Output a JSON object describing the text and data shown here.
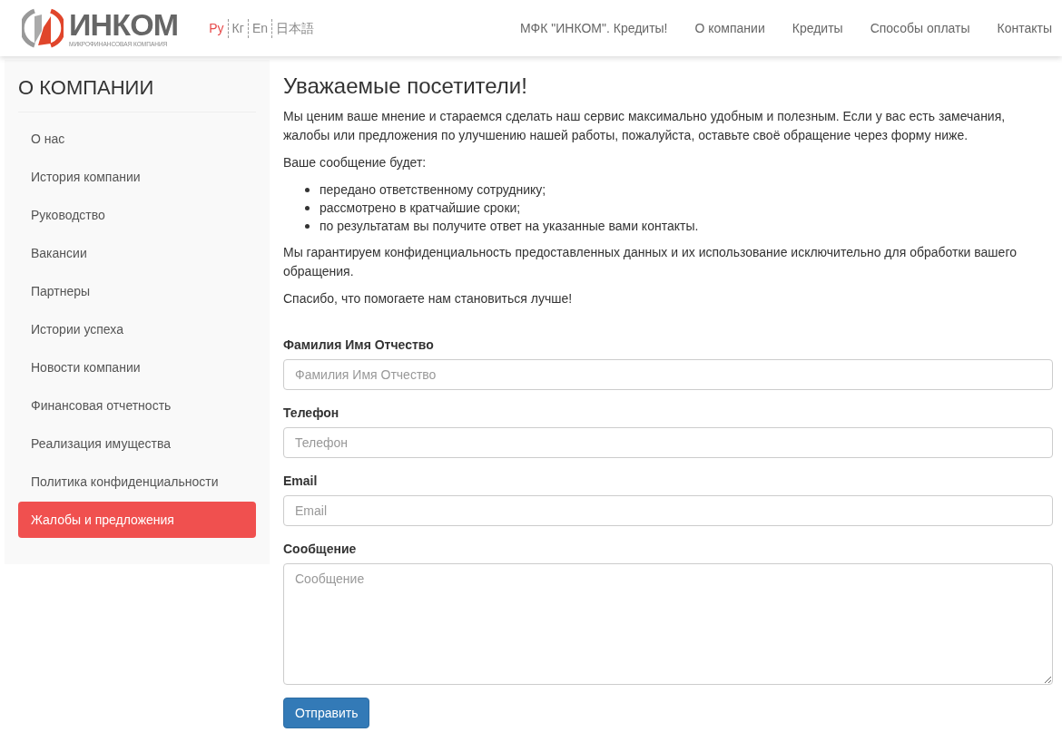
{
  "header": {
    "logo": {
      "name": "ИНКОМ",
      "tagline": "МИКРОФИНАНСОВАЯ КОМПАНИЯ"
    },
    "languages": [
      {
        "label": "Ру",
        "selected": true
      },
      {
        "label": "Кг",
        "selected": false
      },
      {
        "label": "En",
        "selected": false
      },
      {
        "label": "日本語",
        "selected": false
      }
    ],
    "nav": [
      "МФК \"ИНКОМ\". Кредиты!",
      "О компании",
      "Кредиты",
      "Способы оплаты",
      "Контакты"
    ]
  },
  "sidebar": {
    "title": "О КОМПАНИИ",
    "items": [
      {
        "label": "О нас",
        "selected": false
      },
      {
        "label": "История компании",
        "selected": false
      },
      {
        "label": "Руководство",
        "selected": false
      },
      {
        "label": "Вакансии",
        "selected": false
      },
      {
        "label": "Партнеры",
        "selected": false
      },
      {
        "label": "Истории успеха",
        "selected": false
      },
      {
        "label": "Новости компании",
        "selected": false
      },
      {
        "label": "Финансовая отчетность",
        "selected": false
      },
      {
        "label": "Реализация имущества",
        "selected": false
      },
      {
        "label": "Политика конфиденциальности",
        "selected": false
      },
      {
        "label": "Жалобы и предложения",
        "selected": true
      }
    ]
  },
  "main": {
    "heading": "Уважаемые посетители!",
    "intro": "Мы ценим ваше мнение и стараемся сделать наш сервис максимально удобным и полезным. Если у вас есть замечания, жалобы или предложения по улучшению нашей работы, пожалуйста, оставьте своё обращение через форму ниже.",
    "list_intro": "Ваше сообщение будет:",
    "list": [
      "передано ответственному сотруднику;",
      "рассмотрено в кратчайшие сроки;",
      "по результатам вы получите ответ на указанные вами контакты."
    ],
    "privacy": "Мы гарантируем конфиденциальность предоставленных данных и их использование исключительно для обработки вашего обращения.",
    "thanks": "Спасибо, что помогаете нам становиться лучше!",
    "form": {
      "fields": [
        {
          "kind": "input",
          "label": "Фамилия Имя Отчество",
          "placeholder": "Фамилия Имя Отчество"
        },
        {
          "kind": "input",
          "label": "Телефон",
          "placeholder": "Телефон"
        },
        {
          "kind": "input",
          "label": "Email",
          "placeholder": "Email"
        },
        {
          "kind": "textarea",
          "label": "Сообщение",
          "placeholder": "Сообщение"
        }
      ],
      "submit": "Отправить"
    }
  }
}
